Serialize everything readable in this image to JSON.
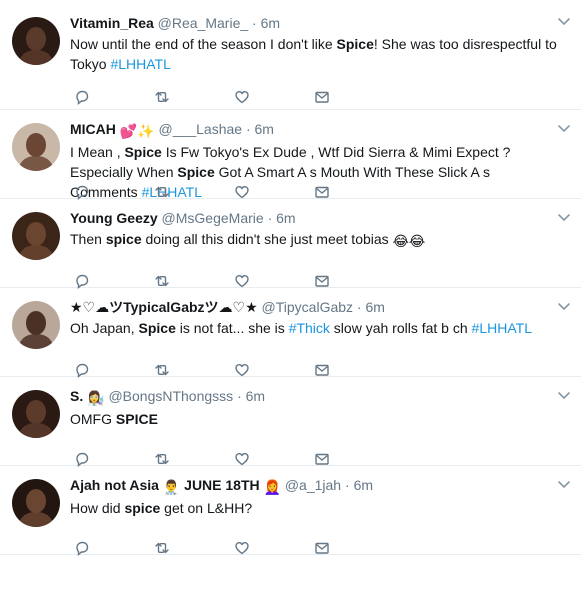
{
  "tweets": [
    {
      "name": "Vitamin_Rea",
      "handle": "@Rea_Marie_",
      "time": "6m",
      "segments": [
        {
          "t": "Now until the end of the season I don't like ",
          "s": "text"
        },
        {
          "t": "Spice",
          "s": "bold"
        },
        {
          "t": "! She was too disrespectful to Tokyo ",
          "s": "text"
        },
        {
          "t": "#LHHATL",
          "s": "tag"
        }
      ],
      "avatar": {
        "bg": "#2a1a14",
        "face": "#5a3a2a"
      }
    },
    {
      "name": "MICAH",
      "name_emoji": "💕✨",
      "handle": "@___Lashae",
      "time": "6m",
      "segments": [
        {
          "t": "I Mean , ",
          "s": "text"
        },
        {
          "t": "Spice",
          "s": "bold"
        },
        {
          "t": " Is Fw Tokyo's Ex Dude , Wtf Did Sierra & Mimi Expect ? Especially When ",
          "s": "text"
        },
        {
          "t": "Spice",
          "s": "bold"
        },
        {
          "t": " Got A Smart A  s Mouth With These Slick A  s Comments ",
          "s": "text"
        },
        {
          "t": "#LHHATL",
          "s": "tag"
        }
      ],
      "avatar": {
        "bg": "#c9b7a8",
        "face": "#6b4634"
      }
    },
    {
      "name": "Young Geezy",
      "handle": "@MsGegeMarie",
      "time": "6m",
      "segments": [
        {
          "t": "Then ",
          "s": "text"
        },
        {
          "t": "spice",
          "s": "bold"
        },
        {
          "t": " doing all this didn't she just meet tobias ",
          "s": "text"
        },
        {
          "t": "😂😂",
          "s": "emoji"
        }
      ],
      "avatar": {
        "bg": "#3b2418",
        "face": "#6a4530"
      }
    },
    {
      "name": "★♡☁ツTypicalGabzツ☁♡★",
      "handle": "@TipycalGabz",
      "time": "6m",
      "segments": [
        {
          "t": "Oh Japan, ",
          "s": "text"
        },
        {
          "t": "Spice",
          "s": "bold"
        },
        {
          "t": " is not fat...  she is ",
          "s": "text"
        },
        {
          "t": "#Thick",
          "s": "tag"
        },
        {
          "t": " slow yah rolls fat b  ch ",
          "s": "text"
        },
        {
          "t": "#LHHATL",
          "s": "tag"
        }
      ],
      "avatar": {
        "bg": "#b9a79a",
        "face": "#4b3025"
      }
    },
    {
      "name": "S.",
      "name_emoji": "👩‍🔬",
      "handle": "@BongsNThongsss",
      "time": "6m",
      "segments": [
        {
          "t": "OMFG ",
          "s": "text"
        },
        {
          "t": "SPICE",
          "s": "bold"
        }
      ],
      "avatar": {
        "bg": "#2b1a14",
        "face": "#5d3b2b"
      }
    },
    {
      "name": "Ajah not Asia",
      "name_emoji": "👨‍⚕️",
      "name_suffix": "JUNE 18TH",
      "suffix_emoji": "👩‍🦰",
      "handle": "@a_1jah",
      "time": "6m",
      "segments": [
        {
          "t": "How did ",
          "s": "text"
        },
        {
          "t": "spice",
          "s": "bold"
        },
        {
          "t": " get on L&HH?",
          "s": "text"
        }
      ],
      "avatar": {
        "bg": "#231510",
        "face": "#6a4532"
      }
    }
  ],
  "meta_separator": "·",
  "icons": {
    "reply": "reply-icon",
    "retweet": "retweet-icon",
    "like": "heart-icon",
    "dm": "envelope-icon",
    "more": "chevron-down-icon"
  },
  "colors": {
    "icon": "#657786",
    "link": "#1b95e0",
    "divider": "#e6ecf0"
  }
}
